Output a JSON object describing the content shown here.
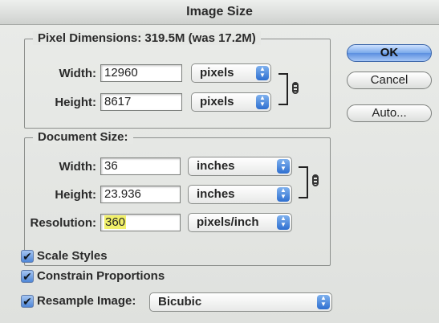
{
  "window": {
    "title": "Image Size"
  },
  "pixel_dimensions": {
    "legend": "Pixel Dimensions:  319.5M (was 17.2M)",
    "width_label": "Width:",
    "width_value": "12960",
    "width_unit": "pixels",
    "height_label": "Height:",
    "height_value": "8617",
    "height_unit": "pixels"
  },
  "document_size": {
    "legend": "Document Size:",
    "width_label": "Width:",
    "width_value": "36",
    "width_unit": "inches",
    "height_label": "Height:",
    "height_value": "23.936",
    "height_unit": "inches",
    "resolution_label": "Resolution:",
    "resolution_value": "360",
    "resolution_unit": "pixels/inch"
  },
  "buttons": {
    "ok": "OK",
    "cancel": "Cancel",
    "auto": "Auto..."
  },
  "options": {
    "scale_styles": {
      "label": "Scale Styles",
      "checked": true
    },
    "constrain_proportions": {
      "label": "Constrain Proportions",
      "checked": true
    },
    "resample_image": {
      "label": "Resample Image:",
      "checked": true,
      "method": "Bicubic"
    }
  },
  "icons": {
    "check": "✔",
    "stepper_up": "▲",
    "stepper_down": "▼"
  },
  "colors": {
    "accent": "#4f86d6",
    "highlight": "#f1f06a"
  }
}
